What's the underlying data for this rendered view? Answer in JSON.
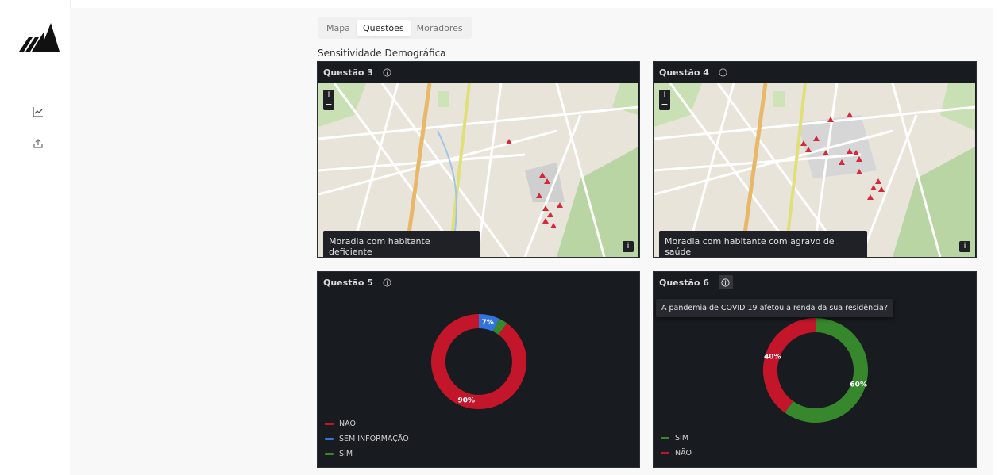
{
  "sidebar": {
    "items": [
      {
        "icon": "chart-line-icon"
      },
      {
        "icon": "upload-icon"
      }
    ]
  },
  "tabs": [
    {
      "label": "Mapa",
      "active": false
    },
    {
      "label": "Questões",
      "active": true
    },
    {
      "label": "Moradores",
      "active": false
    }
  ],
  "section_title": "Sensitividade Demográfica",
  "panels": {
    "q3": {
      "title": "Questão 3",
      "legend": "Moradia com habitante deficiente"
    },
    "q4": {
      "title": "Questão 4",
      "legend": "Moradia com habitante com agravo de saúde"
    },
    "q5": {
      "title": "Questão 5"
    },
    "q6": {
      "title": "Questão 6",
      "tooltip": "A pandemia de COVID 19 afetou a renda da sua residência?"
    }
  },
  "map_controls": {
    "zoom_in": "+",
    "zoom_out": "−",
    "legend_toggle": "i"
  },
  "colors": {
    "red": "#c4162a",
    "blue": "#3274d9",
    "green": "#37872d",
    "panel_bg": "#181b1f"
  },
  "chart_data": [
    {
      "type": "pie",
      "title": "Questão 5",
      "donut": true,
      "labels": [
        "NÃO",
        "SEM INFORMAÇÃO",
        "SIM"
      ],
      "values": [
        90,
        7,
        3
      ],
      "data_labels": [
        "90%",
        "7%",
        ""
      ],
      "colors": [
        "#c4162a",
        "#3274d9",
        "#37872d"
      ],
      "legend": "bottom-left"
    },
    {
      "type": "pie",
      "title": "Questão 6",
      "donut": true,
      "labels": [
        "SIM",
        "NÃO"
      ],
      "values": [
        60,
        40
      ],
      "data_labels": [
        "60%",
        "40%"
      ],
      "colors": [
        "#37872d",
        "#c4162a"
      ],
      "legend": "bottom-left"
    }
  ]
}
